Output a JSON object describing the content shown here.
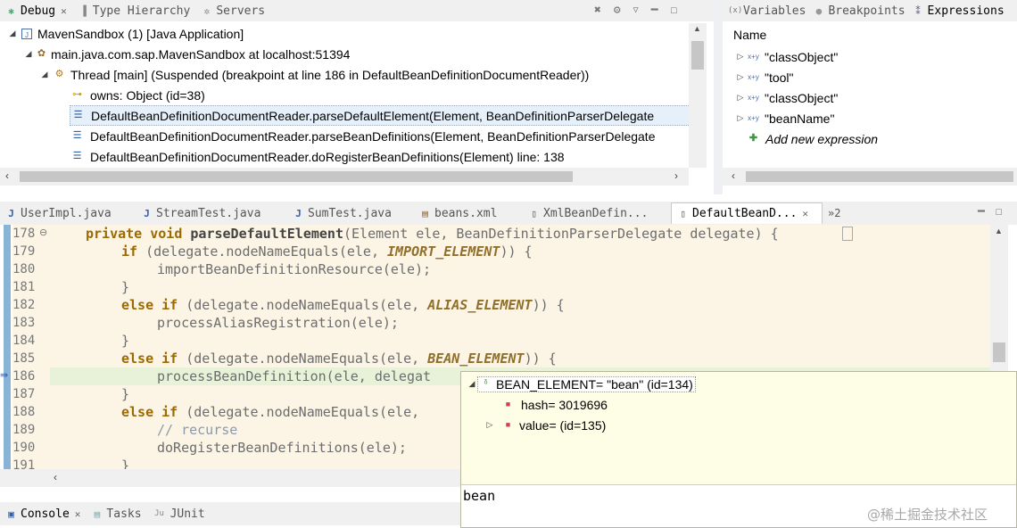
{
  "debug_view": {
    "tabs": [
      {
        "label": "Debug",
        "icon": "debug-icon",
        "close": "✕"
      },
      {
        "label": "Type Hierarchy",
        "icon": "type-hierarchy-icon"
      },
      {
        "label": "Servers",
        "icon": "servers-icon"
      }
    ],
    "tree": [
      {
        "label": "MavenSandbox (1) [Java Application]",
        "icon": "java-app-icon",
        "expanded": true
      },
      {
        "label": "main.java.com.sap.MavenSandbox at localhost:51394",
        "icon": "vm-icon",
        "expanded": true
      },
      {
        "label": "Thread [main] (Suspended (breakpoint at line 186 in DefaultBeanDefinitionDocumentReader))",
        "icon": "thread-suspended-icon",
        "expanded": true
      },
      {
        "label": "owns: Object  (id=38)",
        "icon": "monitor-key-icon"
      },
      {
        "label": "DefaultBeanDefinitionDocumentReader.parseDefaultElement(Element, BeanDefinitionParserDelegate",
        "icon": "stack-frame-icon",
        "selected": true
      },
      {
        "label": "DefaultBeanDefinitionDocumentReader.parseBeanDefinitions(Element, BeanDefinitionParserDelegate",
        "icon": "stack-frame-icon"
      },
      {
        "label": "DefaultBeanDefinitionDocumentReader.doRegisterBeanDefinitions(Element) line: 138",
        "icon": "stack-frame-icon"
      }
    ]
  },
  "expressions_view": {
    "tabs": [
      {
        "label": "Variables",
        "icon": "variables-icon"
      },
      {
        "label": "Breakpoints",
        "icon": "breakpoints-icon"
      },
      {
        "label": "Expressions",
        "icon": "expressions-icon",
        "active": true
      }
    ],
    "column_header": "Name",
    "items": [
      "\"classObject\"",
      "\"tool\"",
      "\"classObject\"",
      "\"beanName\""
    ],
    "add_new": "Add new expression"
  },
  "editor": {
    "tabs": [
      {
        "label": "UserImpl.java",
        "icon": "java-file-icon"
      },
      {
        "label": "StreamTest.java",
        "icon": "java-file-icon"
      },
      {
        "label": "SumTest.java",
        "icon": "java-file-icon"
      },
      {
        "label": "beans.xml",
        "icon": "xml-file-icon"
      },
      {
        "label": "XmlBeanDefin...",
        "icon": "class-file-icon"
      },
      {
        "label": "DefaultBeanD...",
        "icon": "class-file-icon",
        "active": true
      }
    ],
    "overflow_label": "»2",
    "lines": [
      {
        "n": "178",
        "fold": "⊖"
      },
      {
        "n": "179"
      },
      {
        "n": "180"
      },
      {
        "n": "181"
      },
      {
        "n": "182"
      },
      {
        "n": "183"
      },
      {
        "n": "184"
      },
      {
        "n": "185"
      },
      {
        "n": "186",
        "current": true
      },
      {
        "n": "187"
      },
      {
        "n": "188"
      },
      {
        "n": "189"
      },
      {
        "n": "190"
      },
      {
        "n": "191"
      }
    ],
    "code": {
      "l178_kw1": "private",
      "l178_kw2": "void",
      "l178_fn": "parseDefaultElement",
      "l178_rest": "(Element ele, BeanDefinitionParserDelegate delegate) {",
      "l179_kw": "if",
      "l179_a": " (delegate.nodeNameEquals(ele, ",
      "l179_c": "IMPORT_ELEMENT",
      "l179_b": ")) {",
      "l180": "importBeanDefinitionResource(ele);",
      "l181": "}",
      "l182_kw": "else if",
      "l182_a": " (delegate.nodeNameEquals(ele, ",
      "l182_c": "ALIAS_ELEMENT",
      "l182_b": ")) {",
      "l183": "processAliasRegistration(ele);",
      "l184": "}",
      "l185_kw": "else if",
      "l185_a": " (delegate.nodeNameEquals(ele, ",
      "l185_c": "BEAN_ELEMENT",
      "l185_b": ")) {",
      "l186": "processBeanDefinition(ele, delegat",
      "l187": "}",
      "l188_kw": "else if",
      "l188_a": " (delegate.nodeNameEquals(ele, ",
      "l189": "// recurse",
      "l190": "doRegisterBeanDefinitions(ele);",
      "l191": "}"
    }
  },
  "inspect_popup": {
    "root": "BEAN_ELEMENT= \"bean\" (id=134)",
    "children": [
      "hash= 3019696",
      "value= (id=135)"
    ],
    "detail": "bean"
  },
  "bottom_tabs": [
    {
      "label": "Console",
      "icon": "console-icon",
      "close": "✕"
    },
    {
      "label": "Tasks",
      "icon": "tasks-icon"
    },
    {
      "label": "JUnit",
      "icon": "junit-icon"
    }
  ],
  "watermark": "@稀土掘金技术社区",
  "colors": {
    "current_line": "#e8f2d8",
    "popup_bg": "#fefde6",
    "selection": "#e5f0fb",
    "editor_bg": "#fcf4e4"
  }
}
